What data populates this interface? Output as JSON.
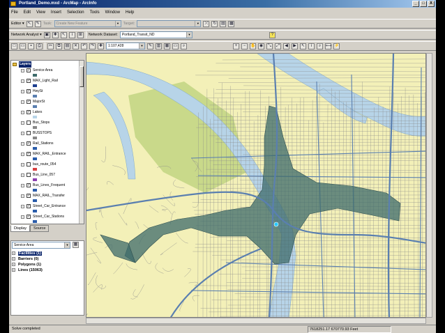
{
  "window": {
    "title": "Portland_Demo.mxd - ArcMap - ArcInfo",
    "minimize": "_",
    "restore": "□",
    "close": "X"
  },
  "menu": [
    "File",
    "Edit",
    "View",
    "Insert",
    "Selection",
    "Tools",
    "Window",
    "Help"
  ],
  "editor_toolbar": {
    "editor_label": "Editor ▾",
    "task_label": "Task:",
    "task_value": "Create New Feature",
    "target_label": "Target:",
    "target_value": ""
  },
  "network_toolbar": {
    "analyst_label": "Network Analyst ▾",
    "dataset_label": "Network Dataset:",
    "dataset_value": "Portland_Transit_ND"
  },
  "standard_toolbar": {
    "scale_value": "1:107,428"
  },
  "toc": {
    "root_label": "Layers",
    "layers": [
      {
        "name": "Service Area",
        "checked": true
      },
      {
        "name": "MAX_Light_Rail",
        "checked": true
      },
      {
        "name": "HwySt",
        "checked": true
      },
      {
        "name": "MajorSt",
        "checked": true
      },
      {
        "name": "Lakes",
        "checked": true
      },
      {
        "name": "Bus_Stops",
        "checked": false
      },
      {
        "name": "BUSSTOPS",
        "checked": false
      },
      {
        "name": "Rail_Stations",
        "checked": true
      },
      {
        "name": "MAX_RAIL_Entrance",
        "checked": true
      },
      {
        "name": "bus_route_054",
        "checked": false
      },
      {
        "name": "Bus_Line_057",
        "checked": false
      },
      {
        "name": "Bus_Lines_Frequent",
        "checked": true
      },
      {
        "name": "MAX_RAIL_Transfer",
        "checked": true
      },
      {
        "name": "Street_Car_Entrance",
        "checked": true
      },
      {
        "name": "Street_Car_Stations",
        "checked": true
      }
    ],
    "tabs": [
      "Display",
      "Source"
    ]
  },
  "network_window": {
    "analysis_layer": "Service Area",
    "items": [
      {
        "label": "Facilities (1)",
        "selected": true
      },
      {
        "label": "Barriers (0)",
        "selected": false
      },
      {
        "label": "Polygons (1)",
        "selected": false
      },
      {
        "label": "Lines (15063)",
        "selected": false
      }
    ]
  },
  "status": {
    "message": "Solve completed",
    "coordinates": "7618251.17  670770.93 Feet"
  },
  "colors": {
    "land": "#f3f0b8",
    "water": "#b7d4e8",
    "park": "#c9d98a",
    "service_area": "#3e6b6b",
    "major_street": "#5a7fb0",
    "minor_street": "#8a8a8a",
    "titlebar": "#0a246a"
  }
}
